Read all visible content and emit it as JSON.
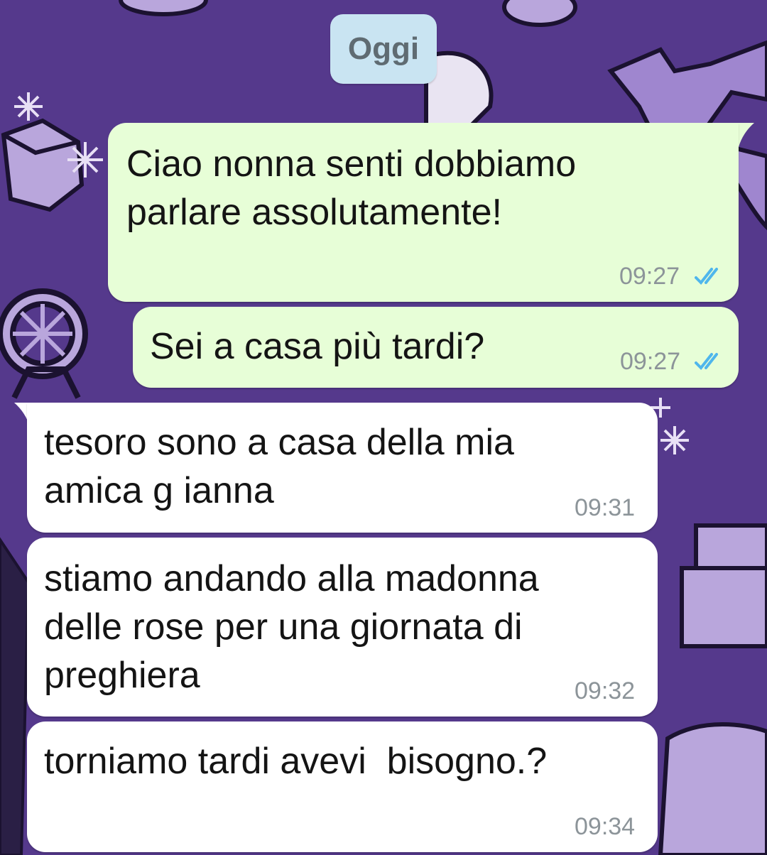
{
  "chat": {
    "date_label": "Oggi",
    "messages": [
      {
        "direction": "outgoing",
        "text": "Ciao nonna senti dobbiamo\nparlare assolutamente!",
        "time": "09:27",
        "status": "read",
        "status_icon": "double-check-icon"
      },
      {
        "direction": "outgoing",
        "text": "Sei a casa più tardi?",
        "time": "09:27",
        "status": "read",
        "status_icon": "double-check-icon"
      },
      {
        "direction": "incoming",
        "text": "tesoro sono a casa della mia\namica g ianna",
        "time": "09:31"
      },
      {
        "direction": "incoming",
        "text": "stiamo andando alla madonna\ndelle rose per una giornata di\npreghiera",
        "time": "09:32"
      },
      {
        "direction": "incoming",
        "text": "torniamo tardi avevi  bisogno.?",
        "time": "09:34"
      }
    ]
  },
  "colors": {
    "wallpaper": "#55398c",
    "outgoing_bubble": "#e7fed7",
    "incoming_bubble": "#ffffff",
    "date_chip": "#c9e4f2",
    "read_ticks": "#4fb6ec"
  }
}
